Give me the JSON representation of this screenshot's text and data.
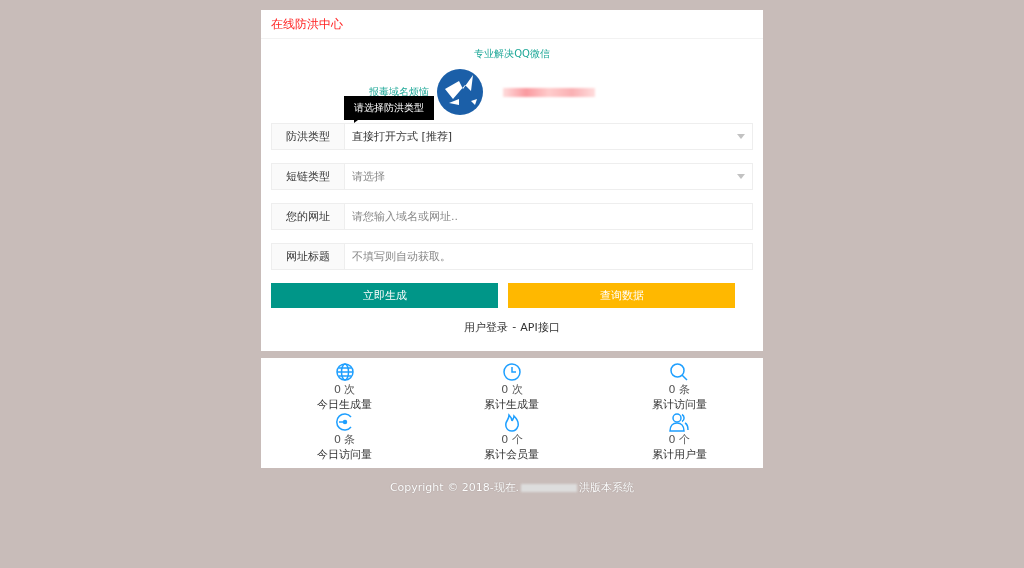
{
  "panel": {
    "title": "在线防洪中心"
  },
  "intro": {
    "line1": "专业解决QQ微信",
    "line2": "报毒域名烦恼"
  },
  "tooltip": "请选择防洪类型",
  "fields": [
    {
      "kind": "select",
      "label": "防洪类型",
      "value": "直接打开方式 [推荐]"
    },
    {
      "kind": "select",
      "label": "短链类型",
      "placeholder": "请选择"
    },
    {
      "kind": "input",
      "label": "您的网址",
      "placeholder": "请您输入域名或网址.."
    },
    {
      "kind": "input",
      "label": "网址标题",
      "placeholder": "不填写则自动获取。"
    }
  ],
  "buttons": [
    {
      "label": "立即生成",
      "color": "#009688"
    },
    {
      "label": "查询数据",
      "color": "#ffb800"
    }
  ],
  "links": {
    "login": "用户登录",
    "separator": "-",
    "api": "API接口"
  },
  "stats": [
    {
      "value": "0 次",
      "label": "今日生成量"
    },
    {
      "value": "0 次",
      "label": "累计生成量"
    },
    {
      "value": "0 条",
      "label": "累计访问量"
    },
    {
      "value": "0 条",
      "label": "今日访问量"
    },
    {
      "value": "0 个",
      "label": "累计会员量"
    },
    {
      "value": "0 个",
      "label": "累计用户量"
    }
  ],
  "footer": {
    "prefix": "Copyright © 2018-现在.",
    "suffix": "洪版本系统"
  }
}
